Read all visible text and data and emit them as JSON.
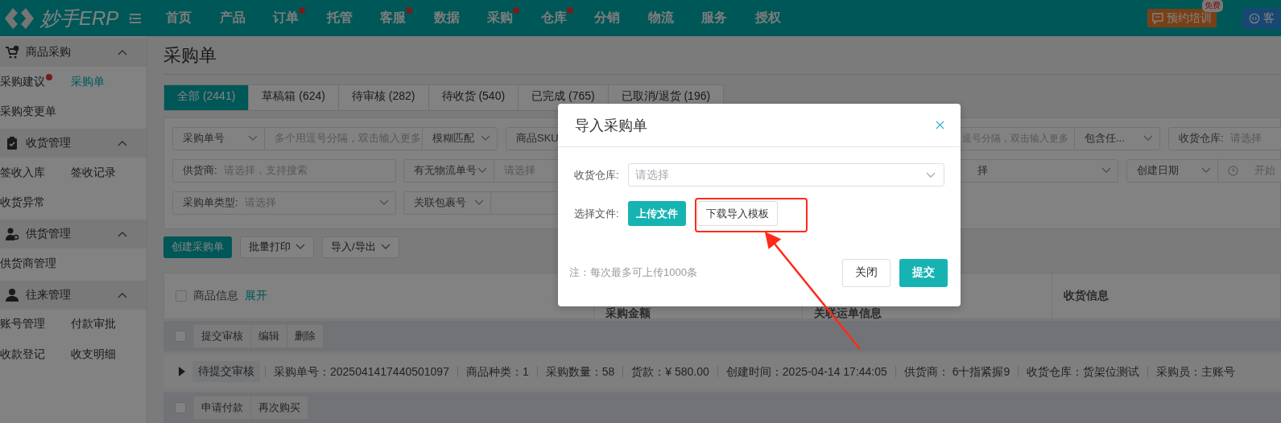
{
  "nav": {
    "logo": "妙手ERP",
    "items": [
      {
        "label": "首页",
        "dot": false
      },
      {
        "label": "产品",
        "dot": false
      },
      {
        "label": "订单",
        "dot": true
      },
      {
        "label": "托管",
        "dot": false
      },
      {
        "label": "客服",
        "dot": true
      },
      {
        "label": "数据",
        "dot": false
      },
      {
        "label": "采购",
        "dot": true
      },
      {
        "label": "仓库",
        "dot": true
      },
      {
        "label": "分销",
        "dot": false
      },
      {
        "label": "物流",
        "dot": false
      },
      {
        "label": "服务",
        "dot": false
      },
      {
        "label": "授权",
        "dot": false
      }
    ],
    "training": {
      "label": "预约培训",
      "badge": "免费"
    },
    "service": {
      "label": "客"
    }
  },
  "sidebar": {
    "groups": [
      {
        "label": "商品采购",
        "expanded": true,
        "items": [
          {
            "label": "采购建议",
            "dot": true,
            "selected": false
          },
          {
            "label": "采购单",
            "dot": false,
            "selected": true
          },
          {
            "label": "采购变更单",
            "dot": false,
            "selected": false
          }
        ]
      },
      {
        "label": "收货管理",
        "expanded": true,
        "items": [
          {
            "label": "签收入库",
            "dot": false,
            "selected": false
          },
          {
            "label": "签收记录",
            "dot": false,
            "selected": false
          },
          {
            "label": "收货异常",
            "dot": false,
            "selected": false
          }
        ]
      },
      {
        "label": "供货管理",
        "expanded": true,
        "items": [
          {
            "label": "供货商管理",
            "dot": false,
            "selected": false
          }
        ]
      },
      {
        "label": "往来管理",
        "expanded": true,
        "items": [
          {
            "label": "账号管理",
            "dot": false,
            "selected": false
          },
          {
            "label": "付款审批",
            "dot": false,
            "selected": false
          },
          {
            "label": "收款登记",
            "dot": false,
            "selected": false
          },
          {
            "label": "收支明细",
            "dot": false,
            "selected": false
          }
        ]
      }
    ]
  },
  "page_title": "采购单",
  "tabs": [
    {
      "label": "全部 (2441)",
      "selected": true
    },
    {
      "label": "草稿箱 (624)",
      "selected": false
    },
    {
      "label": "待审核 (282)",
      "selected": false
    },
    {
      "label": "待收货 (540)",
      "selected": false
    },
    {
      "label": "已完成 (765)",
      "selected": false
    },
    {
      "label": "已取消/退货 (196)",
      "selected": false
    }
  ],
  "filters": [
    [
      [
        {
          "kind": "select",
          "text": "采购单号"
        },
        {
          "kind": "input",
          "text": "多个用逗号分隔，双击输入更多"
        },
        {
          "kind": "select",
          "text": "模糊匹配"
        }
      ],
      [
        {
          "kind": "label",
          "text": "商品SKU"
        },
        {
          "kind": "input",
          "text": "逗号分隔，双击输入更多"
        },
        {
          "kind": "select",
          "text": "包含任..."
        }
      ],
      [
        {
          "kind": "labeled",
          "label": "收货仓库:",
          "text": "请选择"
        }
      ]
    ],
    [
      [
        {
          "kind": "labeled",
          "label": "供货商:",
          "text": "请选择，支持搜索"
        }
      ],
      [
        {
          "kind": "select",
          "text": "有无物流单号"
        },
        {
          "kind": "input",
          "text": "请选择"
        }
      ],
      [
        {
          "kind": "select",
          "text": "择"
        }
      ],
      [
        {
          "kind": "select",
          "text": "创建日期"
        },
        {
          "kind": "date",
          "text": "开始"
        }
      ]
    ],
    [
      [
        {
          "kind": "labeled-select",
          "label": "采购单类型:",
          "text": "请选择"
        }
      ],
      [
        {
          "kind": "select",
          "text": "关联包裹号"
        },
        {
          "kind": "input"
        }
      ]
    ]
  ],
  "actions": [
    {
      "label": "创建采购单",
      "kind": "primary"
    },
    {
      "label": "批量打印",
      "kind": "dropdown"
    },
    {
      "label": "导入/导出",
      "kind": "dropdown"
    }
  ],
  "table": {
    "columns": [
      "商品信息",
      "采购金额",
      "关联运单信息",
      "收货信息"
    ],
    "expand": "展开",
    "all_checked": false,
    "order": {
      "checked": false,
      "row_actions": [
        "提交审核",
        "编辑",
        "删除"
      ],
      "expanded": false,
      "status": "待提交审核",
      "fields": [
        "采购单号：2025041417440501097",
        "商品种类：1",
        "采购数量：58",
        "货款：¥ 580.00",
        "创建时间：2025-04-14 17:44:05",
        "供货商： 6十指紧握9",
        "收货仓库：货架位测试",
        "采购员：主账号"
      ],
      "next_checked": false,
      "next_actions": [
        "申请付款",
        "再次购买"
      ]
    }
  },
  "dialog": {
    "title": "导入采购单",
    "warehouse_label": "收货仓库:",
    "warehouse_placeholder": "请选择",
    "file_label": "选择文件:",
    "upload": "上传文件",
    "download": "下载导入模板",
    "note": "注：每次最多可上传1000条",
    "buttons": [
      {
        "label": "关闭",
        "kind": "default"
      },
      {
        "label": "提交",
        "kind": "primary"
      }
    ]
  }
}
